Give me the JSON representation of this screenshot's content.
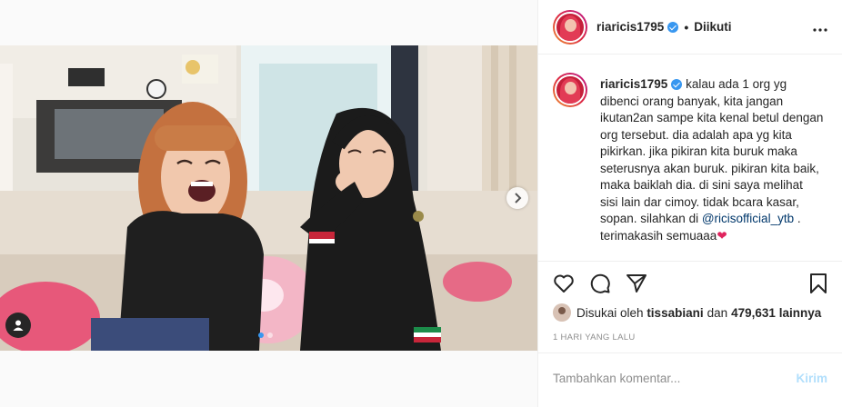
{
  "post": {
    "username": "riaricis1795",
    "follow_status": "Diikuti",
    "more_icon": "more-horizontal-icon",
    "caption": {
      "username": "riaricis1795",
      "text_before_mention": "kalau ada 1 org yg dibenci orang banyak, kita jangan ikutan2an sampe kita kenal betul dengan org tersebut. dia adalah apa yg kita pikirkan. jika pikiran kita buruk maka seterusnya akan buruk. pikiran kita baik, maka baiklah dia. di sini saya melihat sisi lain dar cimoy. tidak bcara kasar, sopan. silahkan di",
      "mention": "@ricisofficial_ytb",
      "text_after_mention": ". terimakasih semuaaa",
      "emoji": "❤"
    },
    "likes": {
      "prefix": "Disukai oleh",
      "liker": "tissabiani",
      "conjunction": "dan",
      "count": "479,631",
      "suffix": "lainnya"
    },
    "timestamp": "1 HARI YANG LALU",
    "comment_placeholder": "Tambahkan komentar...",
    "post_button": "Kirim"
  },
  "carousel": {
    "slide_count": 2,
    "active_index": 0
  },
  "colors": {
    "verified": "#3897f0",
    "link": "#00376b",
    "post_button_disabled": "#b2dffc",
    "muted": "#8e8e8e"
  }
}
